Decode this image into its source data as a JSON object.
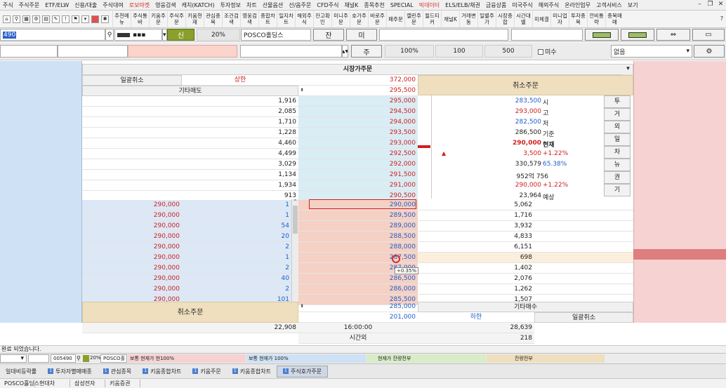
{
  "menu": [
    "주식",
    "주식주문",
    "ETF/ELW",
    "신용/대출",
    "주식대여",
    "로보마켓",
    "영웅검색",
    "캐치(KATCH)",
    "투자정보",
    "차트",
    "선물옵션",
    "선/옵주문",
    "CFD주식",
    "채널K",
    "종목추천",
    "SPECIAL",
    "빅데이터",
    "ELS/ELB/채권",
    "금융상품",
    "미국주식",
    "해외주식",
    "온라인업무",
    "고객서비스",
    "보기"
  ],
  "toolbar_buttons": [
    "추천메뉴",
    "주식통바",
    "키움주문",
    "주식주문",
    "키움현재",
    "관심종목",
    "조건검색",
    "영웅검색",
    "종합차트",
    "일지차트",
    "해외주식",
    "잔고확인",
    "미니주문",
    "호가주문",
    "바로주문",
    "패주문",
    "캘린주문",
    "윌드티커",
    "채널K",
    "거래변동",
    "일별주가",
    "시장종합",
    "시간대별",
    "미체결",
    "미니업자",
    "투자종목",
    "전비통략",
    "종목매매"
  ],
  "order_bar": {
    "code": "490",
    "side_button": "신",
    "ratio": "20%",
    "stock_name": "POSCO홀딩스",
    "balance_btn": "잔",
    "unfilled_btn": "미",
    "order_btn": "주",
    "percent": "100%",
    "qty1": "100",
    "qty2": "500",
    "unfilled_check": "미수",
    "condition": "없음"
  },
  "grid": {
    "market_order_title": "시장가주문",
    "cancel_all": "일괄취소",
    "upper_limit": "상한",
    "upper_price": "372,000",
    "other_sell": "기타매도",
    "other_sell_price": "295,500",
    "cancel_order": "취소주문",
    "asks": [
      {
        "qty": "1,916",
        "price": "295,000"
      },
      {
        "qty": "2,085",
        "price": "294,500"
      },
      {
        "qty": "1,710",
        "price": "294,000"
      },
      {
        "qty": "1,228",
        "price": "293,500"
      },
      {
        "qty": "4,460",
        "price": "293,000"
      },
      {
        "qty": "4,499",
        "price": "292,500"
      },
      {
        "qty": "3,029",
        "price": "292,000"
      },
      {
        "qty": "1,134",
        "price": "291,500"
      },
      {
        "qty": "1,934",
        "price": "291,000"
      },
      {
        "qty": "913",
        "price": "290,500"
      }
    ],
    "bids": [
      {
        "order_price": "290,000",
        "order_qty": "1",
        "price": "290,000",
        "qty": "5,062"
      },
      {
        "order_price": "290,000",
        "order_qty": "1",
        "price": "289,500",
        "qty": "1,716"
      },
      {
        "order_price": "290,000",
        "order_qty": "54",
        "price": "289,000",
        "qty": "3,932"
      },
      {
        "order_price": "290,000",
        "order_qty": "20",
        "price": "288,500",
        "qty": "4,833"
      },
      {
        "order_price": "290,000",
        "order_qty": "2",
        "price": "288,000",
        "qty": "6,151"
      },
      {
        "order_price": "290,000",
        "order_qty": "1",
        "price": "287,500",
        "qty": "698"
      },
      {
        "order_price": "290,000",
        "order_qty": "2",
        "price": "287,000",
        "qty": "1,402"
      },
      {
        "order_price": "290,000",
        "order_qty": "40",
        "price": "286,500",
        "qty": "2,076"
      },
      {
        "order_price": "290,000",
        "order_qty": "2",
        "price": "286,000",
        "qty": "1,262"
      },
      {
        "order_price": "290,000",
        "order_qty": "101",
        "price": "285,500",
        "qty": "1,507"
      }
    ],
    "other_buy_price": "285,000",
    "other_buy": "기타매수",
    "lower_price": "201,000",
    "lower_limit": "하한",
    "cancel_all_right": "일괄취소",
    "total_ask": "22,908",
    "time": "16:00:00",
    "total_bid": "28,639",
    "after_hours": "시간외",
    "after_hours_qty": "218",
    "tooltip": "+0.35%"
  },
  "info": {
    "open": "283,500",
    "open_label": "시",
    "high": "293,000",
    "high_label": "고",
    "low": "282,500",
    "low_label": "저",
    "base": "286,500",
    "base_label": "기준",
    "current": "290,000",
    "current_label": "현재",
    "change": "3,500",
    "change_pct": "+1.22%",
    "volume": "330,579",
    "volume_pct": "65.38%",
    "amount": "952억 756",
    "expected": "290,000",
    "expected_pct": "+1.22%",
    "expected_qty": "23,964",
    "expected_label": "예상"
  },
  "side_tabs": [
    "투",
    "거",
    "외",
    "일",
    "차",
    "뉴",
    "권",
    "기"
  ],
  "status_message": "완료 되었습니다.",
  "bottom": {
    "code": "005490",
    "ratio": "20%",
    "stock": "POSCO홀",
    "seg1": "보통  현재가  현100%",
    "seg2": "보통  현재가  100%",
    "seg3": "현재가  잔량전부",
    "seg4": "잔량전부"
  },
  "tabs": [
    "일대비등락률",
    "투자자별매매종",
    "관심종목",
    "키움종합차트",
    "키움주문",
    "키움종합차트",
    "주식호가주문"
  ],
  "stocks": [
    "POSCO홀딩스",
    "현대차",
    "삼성전자",
    "키움증권"
  ],
  "colors": {
    "bid_side": "#cfe1f4",
    "ask_side": "#f6d2d2",
    "beige": "#efdfbf",
    "up": "#d02020",
    "down": "#2060c8"
  }
}
